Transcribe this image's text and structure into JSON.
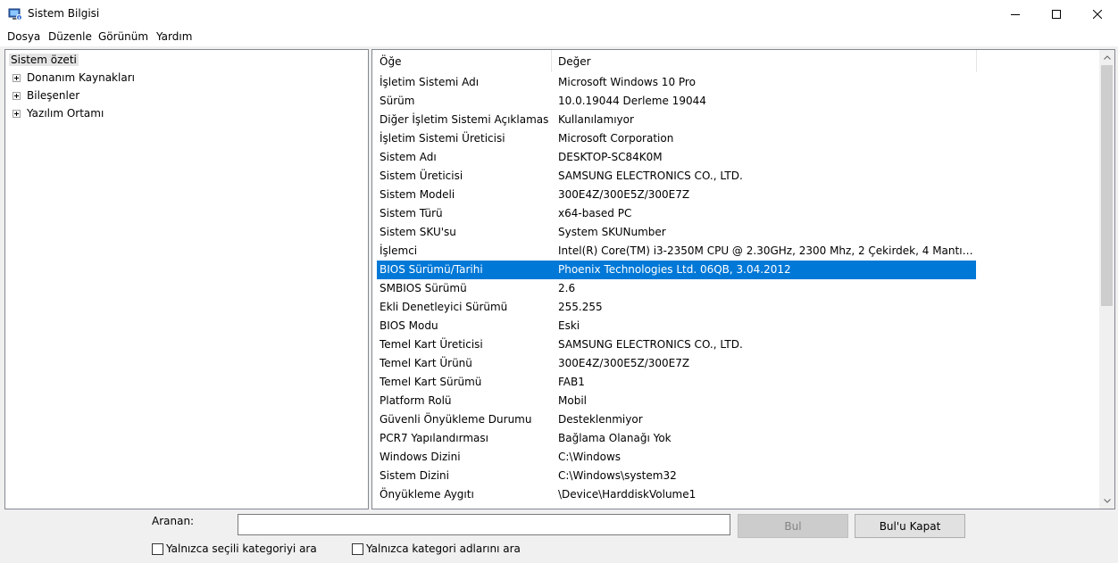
{
  "window": {
    "title": "Sistem Bilgisi",
    "icon": "system-info-icon",
    "controls": [
      "minimize-icon",
      "maximize-icon",
      "close-icon"
    ]
  },
  "menu": [
    "Dosya",
    "Düzenle",
    "Görünüm",
    "Yardım"
  ],
  "tree": {
    "root": "Sistem özeti",
    "children": [
      "Donanım Kaynakları",
      "Bileşenler",
      "Yazılım Ortamı"
    ]
  },
  "list": {
    "columns": [
      "Öğe",
      "Değer"
    ],
    "selected_index": 10,
    "selection_color": "#0078d7",
    "rows": [
      [
        "İşletim Sistemi Adı",
        "Microsoft Windows 10 Pro"
      ],
      [
        "Sürüm",
        "10.0.19044 Derleme 19044"
      ],
      [
        "Diğer İşletim Sistemi Açıklaması",
        "Kullanılamıyor"
      ],
      [
        "İşletim Sistemi Üreticisi",
        "Microsoft Corporation"
      ],
      [
        "Sistem Adı",
        "DESKTOP-SC84K0M"
      ],
      [
        "Sistem Üreticisi",
        "SAMSUNG ELECTRONICS CO., LTD."
      ],
      [
        "Sistem Modeli",
        "300E4Z/300E5Z/300E7Z"
      ],
      [
        "Sistem Türü",
        "x64-based PC"
      ],
      [
        "Sistem SKU'su",
        "System SKUNumber"
      ],
      [
        "İşlemci",
        "Intel(R) Core(TM) i3-2350M CPU @ 2.30GHz, 2300 Mhz, 2 Çekirdek, 4 Mantıks..."
      ],
      [
        "BIOS Sürümü/Tarihi",
        "Phoenix Technologies Ltd. 06QB, 3.04.2012"
      ],
      [
        "SMBIOS Sürümü",
        "2.6"
      ],
      [
        "Ekli Denetleyici Sürümü",
        "255.255"
      ],
      [
        "BIOS Modu",
        "Eski"
      ],
      [
        "Temel Kart Üreticisi",
        "SAMSUNG ELECTRONICS CO., LTD."
      ],
      [
        "Temel Kart Ürünü",
        "300E4Z/300E5Z/300E7Z"
      ],
      [
        "Temel Kart Sürümü",
        "FAB1"
      ],
      [
        "Platform Rolü",
        "Mobil"
      ],
      [
        "Güvenli Önyükleme Durumu",
        "Desteklenmiyor"
      ],
      [
        "PCR7 Yapılandırması",
        "Bağlama Olanağı Yok"
      ],
      [
        "Windows Dizini",
        "C:\\Windows"
      ],
      [
        "Sistem Dizini",
        "C:\\Windows\\system32"
      ],
      [
        "Önyükleme Aygıtı",
        "\\Device\\HarddiskVolume1"
      ]
    ]
  },
  "search": {
    "label": "Aranan:",
    "value": "",
    "find_button": "Bul",
    "close_find_button": "Bul'u Kapat",
    "option_selected_category": "Yalnızca seçili kategoriyi ara",
    "option_category_names": "Yalnızca kategori adlarını ara"
  }
}
